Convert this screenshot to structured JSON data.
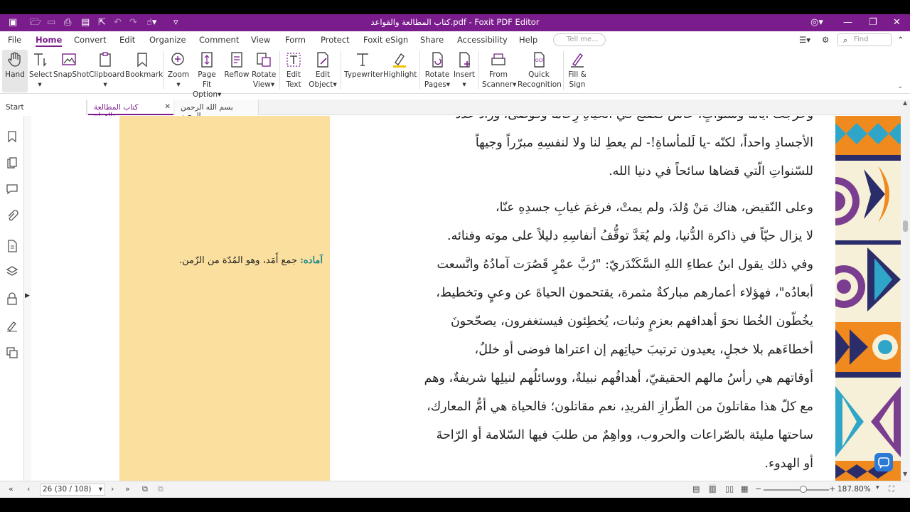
{
  "window": {
    "title": "كتاب المطالعة والقواعد.pdf - Foxit PDF Editor"
  },
  "menu": {
    "items": [
      "File",
      "Home",
      "Convert",
      "Edit",
      "Organize",
      "Comment",
      "View",
      "Form",
      "Protect",
      "Foxit eSign",
      "Share",
      "Accessibility",
      "Help"
    ],
    "tell_me_placeholder": "Tell me...",
    "find_placeholder": "Find"
  },
  "ribbon": {
    "hand": "Hand",
    "select": "Select",
    "snapshot": "SnapShot",
    "clipboard": "Clipboard",
    "bookmark": "Bookmark",
    "zoom": "Zoom",
    "page_fit_1": "Page Fit",
    "page_fit_2": "Option",
    "reflow": "Reflow",
    "rotate_view_1": "Rotate",
    "rotate_view_2": "View",
    "edit_text_1": "Edit",
    "edit_text_2": "Text",
    "edit_object_1": "Edit",
    "edit_object_2": "Object",
    "typewriter": "Typewriter",
    "highlight": "Highlight",
    "rotate_pages_1": "Rotate",
    "rotate_pages_2": "Pages",
    "insert": "Insert",
    "from_scanner_1": "From",
    "from_scanner_2": "Scanner",
    "quick_recognition_1": "Quick",
    "quick_recognition_2": "Recognition",
    "fill_sign_1": "Fill &",
    "fill_sign_2": "Sign"
  },
  "tabs": {
    "start": "Start",
    "doc1": "كتاب المطالعة والقواع...",
    "doc2": "بسم الله الرحمن الرحيم"
  },
  "document": {
    "top_lines": [
      "وخرجتْ أياماً وسنواتٍ، عاشَ فصنعَ في الحياةِ زِحاماً وفوضى، وزادَ عددَ",
      "الأجسادِ واحداً، لكنّه -يا لَلمأساةِ!- لم يعطِ لنا ولا لنفسِهِ مبرّراً وجيهاً",
      "للسّنواتِ الّتي قضاها سائحاً في دنيا الله."
    ],
    "para_lines": [
      "وعلى النّقيض، هناك مَنْ وُلدَ، ولم يمتْ، فرغمَ غيابِ جسدِهِ عنّا،",
      "لا يزال حيّاً في ذاكرة الدُّنيا، ولم يُعَدَّ توقُّفُ أنفاسِهِ دليلاً على موته وفنائه.",
      "وفي ذلك يقول ابنُ عطاءِ اللهِ السَّكَنْدَريّ: \"رُبَّ عمْرٍ قَصُرَت آمادُهُ واتَّسعت",
      "أبعادُه\"، فهؤلاء أعمارهم مباركةٌ مثمرة، يقتحمون الحياةَ عن وعيٍ وتخطيط،",
      "يخُطّون الخُطا نحوَ أهدافهم بعزمٍ وثبات، يُخطِئون فيستغفرون، يصحّحونَ",
      "أخطاءَهم بلا خجلٍ، يعيدون ترتيبَ حياتِهم إن اعتراها فوضى أو خللٌ،",
      "أوقاتهم هي رأسُ مالهم الحقيقيّ، أهدافُهم نبيلةٌ، ووسائلُهم لنيلِها شريفةٌ، وهم",
      "مع كلّ هذا مقاتلونَ من الطّرازِ الفريدِ، نعم مقاتلون؛ فالحياة هي أمُّ المعارك،",
      "ساحتها مليئة بالصّراعات والحروب، وواهِمٌ من طلبَ فيها السّلامة أو الرّاحةَ",
      "أو الهدوء."
    ],
    "note_keyword": "آماده:",
    "note_text": "جمع أَمَد، وهو المُدّة من الزّمن."
  },
  "status": {
    "page_indicator": "26 (30 / 108)",
    "zoom": "187.80%"
  },
  "colors": {
    "accent": "#7a1c8c",
    "margin": "#fbdf9e",
    "keyword": "#1d8a8a"
  }
}
